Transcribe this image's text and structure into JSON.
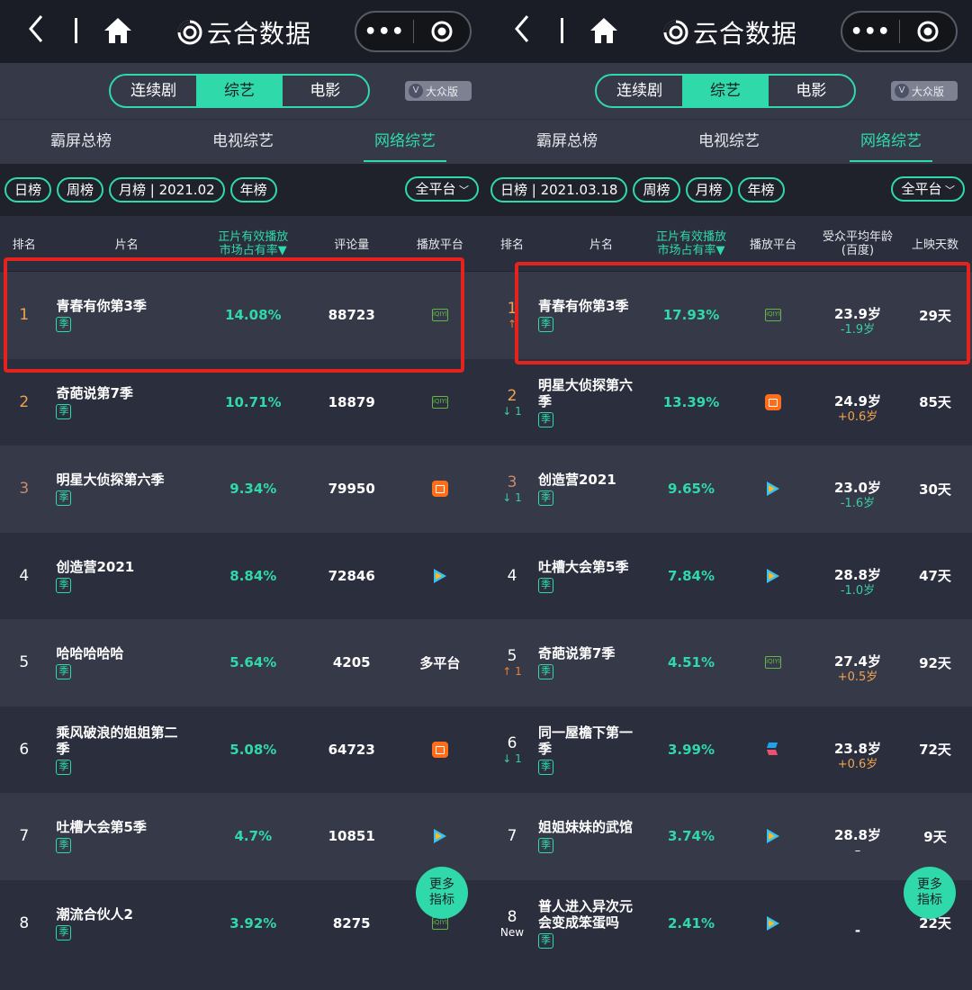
{
  "nav": {
    "brand": "云合数据",
    "capsule_dots": "•••"
  },
  "type_tabs": [
    "连续剧",
    "综艺",
    "电影"
  ],
  "type_active": 1,
  "edition": "大众版",
  "edition_mark": "V",
  "category_tabs": [
    "霸屏总榜",
    "电视综艺",
    "网络综艺"
  ],
  "category_active": 2,
  "left": {
    "filters": [
      "日榜",
      "周榜",
      "月榜 | 2021.02",
      "年榜"
    ],
    "platform_filter": "全平台",
    "headers": {
      "rank": "排名",
      "title": "片名",
      "share_line1": "正片有效播放",
      "share_line2": "市场占有率▼",
      "comments": "评论量",
      "platform": "播放平台"
    },
    "rows": [
      {
        "rank": "1",
        "title_line1": "青春有你第3季",
        "title_line2": "",
        "tag": "季",
        "share": "14.08%",
        "comments": "88723",
        "platform": "iqiyi"
      },
      {
        "rank": "2",
        "title_line1": "奇葩说第7季",
        "title_line2": "",
        "tag": "季",
        "share": "10.71%",
        "comments": "18879",
        "platform": "iqiyi"
      },
      {
        "rank": "3",
        "title_line1": "明星大侦探第六季",
        "title_line2": "",
        "tag": "季",
        "share": "9.34%",
        "comments": "79950",
        "platform": "mgtv"
      },
      {
        "rank": "4",
        "title_line1": "创造营2021",
        "title_line2": "",
        "tag": "季",
        "share": "8.84%",
        "comments": "72846",
        "platform": "tencent"
      },
      {
        "rank": "5",
        "title_line1": "哈哈哈哈哈",
        "title_line2": "",
        "tag": "季",
        "share": "5.64%",
        "comments": "4205",
        "platform": "text",
        "platform_text": "多平台"
      },
      {
        "rank": "6",
        "title_line1": "乘风破浪的姐姐第二",
        "title_line2": "季",
        "tag": "季",
        "share": "5.08%",
        "comments": "64723",
        "platform": "mgtv"
      },
      {
        "rank": "7",
        "title_line1": "吐槽大会第5季",
        "title_line2": "",
        "tag": "季",
        "share": "4.7%",
        "comments": "10851",
        "platform": "tencent"
      },
      {
        "rank": "8",
        "title_line1": "潮流合伙人2",
        "title_line2": "",
        "tag": "季",
        "share": "3.92%",
        "comments": "8275",
        "platform": "iqiyi"
      }
    ],
    "more_button": "更多指标"
  },
  "right": {
    "filters": [
      "日榜 | 2021.03.18",
      "周榜",
      "月榜",
      "年榜"
    ],
    "platform_filter": "全平台",
    "headers": {
      "rank": "排名",
      "title": "片名",
      "share_line1": "正片有效播放",
      "share_line2": "市场占有率▼",
      "platform": "播放平台",
      "age_line1": "受众平均年龄",
      "age_line2": "(百度)",
      "days": "上映天数"
    },
    "rows": [
      {
        "rank": "1",
        "change": "↑",
        "change_type": "up",
        "title_line1": "青春有你第3季",
        "title_line2": "",
        "tag": "季",
        "share": "17.93%",
        "platform": "iqiyi",
        "age": "23.9岁",
        "delta": "-1.9岁",
        "delta_type": "minus",
        "days": "29天"
      },
      {
        "rank": "2",
        "change": "↓ 1",
        "change_type": "down",
        "title_line1": "明星大侦探第六",
        "title_line2": "季",
        "tag": "季",
        "share": "13.39%",
        "platform": "mgtv",
        "age": "24.9岁",
        "delta": "+0.6岁",
        "delta_type": "plus",
        "days": "85天"
      },
      {
        "rank": "3",
        "change": "↓ 1",
        "change_type": "down",
        "title_line1": "创造营2021",
        "title_line2": "",
        "tag": "季",
        "share": "9.65%",
        "platform": "tencent",
        "age": "23.0岁",
        "delta": "-1.6岁",
        "delta_type": "minus",
        "days": "30天"
      },
      {
        "rank": "4",
        "change": "",
        "change_type": "",
        "title_line1": "吐槽大会第5季",
        "title_line2": "",
        "tag": "季",
        "share": "7.84%",
        "platform": "tencent",
        "age": "28.8岁",
        "delta": "-1.0岁",
        "delta_type": "minus",
        "days": "47天"
      },
      {
        "rank": "5",
        "change": "↑ 1",
        "change_type": "up",
        "title_line1": "奇葩说第7季",
        "title_line2": "",
        "tag": "季",
        "share": "4.51%",
        "platform": "iqiyi",
        "age": "27.4岁",
        "delta": "+0.5岁",
        "delta_type": "plus",
        "days": "92天"
      },
      {
        "rank": "6",
        "change": "↓ 1",
        "change_type": "down",
        "title_line1": "同一屋檐下第一",
        "title_line2": "季",
        "tag": "季",
        "share": "3.99%",
        "platform": "bilibili",
        "age": "23.8岁",
        "delta": "+0.6岁",
        "delta_type": "plus",
        "days": "72天"
      },
      {
        "rank": "7",
        "change": "",
        "change_type": "",
        "title_line1": "姐姐妹妹的武馆",
        "title_line2": "",
        "tag": "季",
        "share": "3.74%",
        "platform": "tencent",
        "age": "28.8岁",
        "delta": "–",
        "delta_type": "",
        "days": "9天"
      },
      {
        "rank": "8",
        "change": "New",
        "change_type": "new",
        "title_line1": "普人进入异次元",
        "title_line2": "会变成笨蛋吗",
        "tag": "季",
        "share": "2.41%",
        "platform": "tencent",
        "age": "-",
        "delta": "",
        "delta_type": "",
        "days": "22天"
      }
    ],
    "more_button": "更多指标"
  },
  "colors": {
    "accent": "#2fd9a9",
    "highlight_box": "#e4231f",
    "rank_gold": "#f0a44f",
    "rank_bronze": "#c98b6a"
  }
}
